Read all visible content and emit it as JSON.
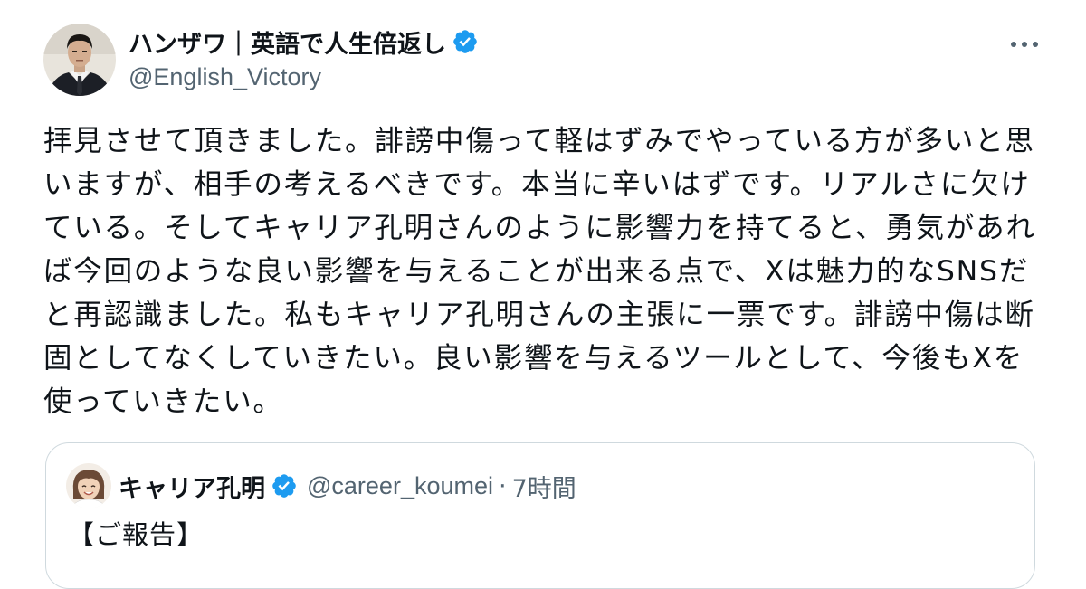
{
  "tweet": {
    "author": {
      "display_name": "ハンザワ｜英語で人生倍返し",
      "handle": "@English_Victory",
      "verified": true,
      "avatar_icon": "avatar-man-in-suit"
    },
    "more_icon": "more-dots-icon",
    "text": "拝見させて頂きました。誹謗中傷って軽はずみでやっている方が多いと思\nいますが、相手の考えるべきです。本当に辛いはずです。リアルさに欠け\nている。そしてキャリア孔明さんのように影響力を持てると、勇気があれ\nば今回のような良い影響を与えることが出来る点で、Xは魅力的なSNSだ\nと再認識ました。私もキャリア孔明さんの主張に一票です。誹謗中傷は断\n固としてなくしていきたい。良い影響を与えるツールとして、今後もXを\n使っていきたい。",
    "quoted": {
      "display_name": "キャリア孔明",
      "handle": "@career_koumei",
      "separator": "·",
      "time": "7時間",
      "verified": true,
      "avatar_icon": "avatar-illustrated-person",
      "text": "【ご報告】"
    }
  },
  "colors": {
    "text_primary": "#0f1419",
    "text_secondary": "#536471",
    "verified_blue": "#1d9bf0",
    "border": "#cfd9de"
  }
}
